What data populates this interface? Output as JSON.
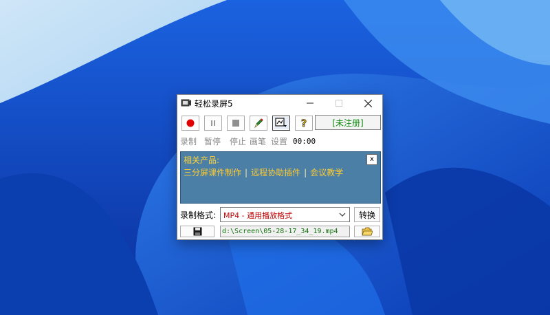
{
  "window": {
    "title": "轻松录屏5",
    "minimize_label": "—",
    "maximize_label": "☐",
    "close_label": "✕"
  },
  "toolbar": {
    "status": "[未注册]",
    "labels": [
      "录制",
      "暂停",
      "停止",
      "画笔",
      "设置"
    ],
    "timer": "00:00"
  },
  "promo": {
    "title": "相关产品:",
    "links": [
      "三分屏课件制作",
      "远程协助插件",
      "会议教学"
    ],
    "separator": "|",
    "close_label": "x"
  },
  "format": {
    "label": "录制格式:",
    "selected": "MP4 - 通用播放格式",
    "convert_label": "转换"
  },
  "output": {
    "path": "d:\\Screen\\05-28-17_34_19.mp4"
  },
  "colors": {
    "record": "#e00000",
    "panel_bg": "#4b7fa6",
    "link": "#ffcc33",
    "status_text": "#0c8a0c"
  }
}
